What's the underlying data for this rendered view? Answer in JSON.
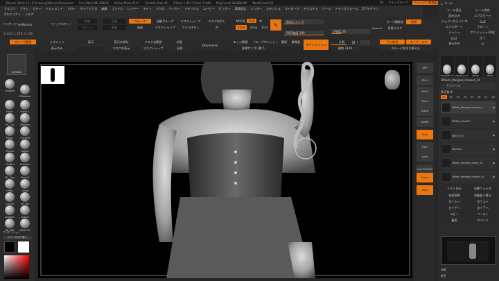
{
  "titlebar": {
    "app": "ZBrush 2024.0.1 [Z.D.many]ZBrush Document",
    "mem": "Free Mem 86.308GB",
    "active": "Active Mem 5147",
    "scratch": "Scratch Disk 45",
    "ztime": "ZTime 1.447 ATime 7.448",
    "poly": "PolyCount 28.958 MP",
    "mesh": "MeshCount 81",
    "right_ac": "AC",
    "quicksave": "クイックセーブ",
    "window_alpha": "ウィンドウ透過度",
    "menu_label": "メニュー",
    "default_script": "DefaultZScript"
  },
  "menu": {
    "row1": [
      "アルファ",
      "ブラシ",
      "カラー",
      "ドキュメント",
      "ドロー",
      "ダイナミクス",
      "編集",
      "ファイル",
      "レイヤー",
      "ライト",
      "マクロ",
      "マーカー",
      "マテリアル",
      "ムービー",
      "ピッカー",
      "環境設定",
      "レンダー",
      "ステンシル",
      "ストローク",
      "テクスチャ",
      "ツール",
      "トランスフォーム",
      "Zプラグイン"
    ],
    "row2": [
      "Zスクリプト",
      "ヘルプ"
    ]
  },
  "toolbar": {
    "light_box": "ライトボックス",
    "live_boolean": "LiveBoolean",
    "quick_sketch": "クイックスケッチ",
    "move": "移動",
    "scale": "スケール",
    "rotate": "回転",
    "edit": "編集",
    "draw": "描画",
    "smooth": "スムーズ",
    "auto_group": "自動グループ",
    "mask_sharpen": "マスクシャープ",
    "mask_blur": "マスクぼかし",
    "mrgb": "MRGB",
    "rgb": "RGB",
    "m": "M",
    "zadd": "Zadd",
    "zsub": "Zsub",
    "zcut": "Zcut",
    "focal_shift": "焦点シフト 0",
    "z_intensity": "Z強度 26",
    "draw_size": "ドローサイズ 64",
    "dynamic": "Dynamic",
    "curve_mode": "カーブ機能化",
    "spotlight": "同期",
    "brush_mask": "背面マスク",
    "rgb_intensity": "RGB強度 100",
    "pos": "-0.322,-1.546,-0.108",
    "group_selection": "グループ選択",
    "row_a": [
      "ジオメトリ",
      "表示",
      "表示の保存",
      "マスク全範囲",
      "反転"
    ],
    "row_b": [
      "表示のみ",
      "マスク非表示",
      "マスクのぼかし",
      "マスクシャープ",
      "分割"
    ],
    "dynamesh": "ダイナメッシュ",
    "divide": "分割",
    "poly_count": "総数 2144",
    "group_polish": "グループポリッシュ",
    "target_polycount": "目標ポリゴン数 5",
    "edge_loop": "エッジ最適",
    "merge_down": "下と結合",
    "simple": "簡易",
    "res": "解像度",
    "plus": "+",
    "stage": "ステージを切り替える",
    "curve_cloth": "カーブ・ステ",
    "zremesher": "ZRemesher"
  },
  "left": {
    "lightbox_btn": "LightBox",
    "brushes": [
      {
        "name": "Smooth"
      },
      {
        "name": "ZModeler"
      },
      {
        "name": "Move"
      },
      {
        "name": "Move T"
      },
      {
        "name": "SK_Cla"
      },
      {
        "name": "ZRemes"
      },
      {
        "name": "Polish"
      },
      {
        "name": "CurveM"
      },
      {
        "name": "hPolish"
      },
      {
        "name": "Flatten"
      },
      {
        "name": "ClayBui"
      },
      {
        "name": "Standar"
      },
      {
        "name": "SK_Clay"
      },
      {
        "name": "Slash3"
      },
      {
        "name": "Inflat"
      },
      {
        "name": "Chisel"
      },
      {
        "name": "CurveT"
      },
      {
        "name": "SK_Hai"
      },
      {
        "name": "ArtDam"
      },
      {
        "name": "Groom"
      },
      {
        "name": "SK_Mfil"
      },
      {
        "name": "Metal Pe"
      }
    ],
    "gradient": "グラデーション",
    "color_switch": "カラーの切り替え"
  },
  "vshelf": [
    {
      "label": "BPR"
    },
    {
      "label": "SPix 3"
    },
    {
      "label": "Scroll"
    },
    {
      "label": "Zoom"
    },
    {
      "label": "Actual"
    },
    {
      "label": "AAHalf"
    },
    {
      "label": "Persp"
    },
    {
      "label": "Floor"
    },
    {
      "label": "Local"
    },
    {
      "label": "Line Fill PolyF"
    },
    {
      "label": "Frame"
    },
    {
      "label": "Move"
    }
  ],
  "right": {
    "header": "ツール",
    "buttons": [
      "ツール読込",
      "ツール保存",
      "読み込み",
      "エクスポート",
      "プロジェクトからインポート",
      "GoZ",
      "エクスポート",
      "クローン",
      "メッシュ",
      "ポリメッシュ3D化",
      "GoZ",
      "全て",
      "表示のみ",
      "R"
    ],
    "subtool_header": "サブツール",
    "visible_count": "表示数 8",
    "subtool_tabs": [
      "V1",
      "V2",
      "V3",
      "V4",
      "V5",
      "V6",
      "V7",
      "V8"
    ],
    "subtools": [
      {
        "name": "UMesh_Merged_nmodel_4"
      },
      {
        "name": "PM3D_Cube3D1"
      },
      {
        "name": "自衣えもの"
      },
      {
        "name": "Extract2"
      },
      {
        "name": "UMesh_Merged_rmesh_35"
      },
      {
        "name": "UMesh_Merged_nmodel_42"
      }
    ],
    "tool_thumbs": [
      "SimpleBrush",
      "UMesh_Merged_mmosel_2",
      "UMesh",
      "UMesh"
    ],
    "list_all": "リスト表示",
    "list_count": "自動フォルダ",
    "actions": [
      "名前変更",
      "自動並べ替え",
      "全て上へ",
      "全て上へ",
      "全て下へ",
      "全て下へ",
      "コピー",
      "ペースト",
      "複製",
      "アペンド"
    ],
    "bottom": [
      "分割",
      "結合"
    ],
    "tool_name": "UMesh_Merged_nmosel_44"
  },
  "colors": {
    "accent": "#e9760f",
    "panel": "#2b2b2b",
    "canvas": "#000000"
  },
  "canvas": {
    "pos_readout": "-0.322,-1.546,-0.108"
  }
}
